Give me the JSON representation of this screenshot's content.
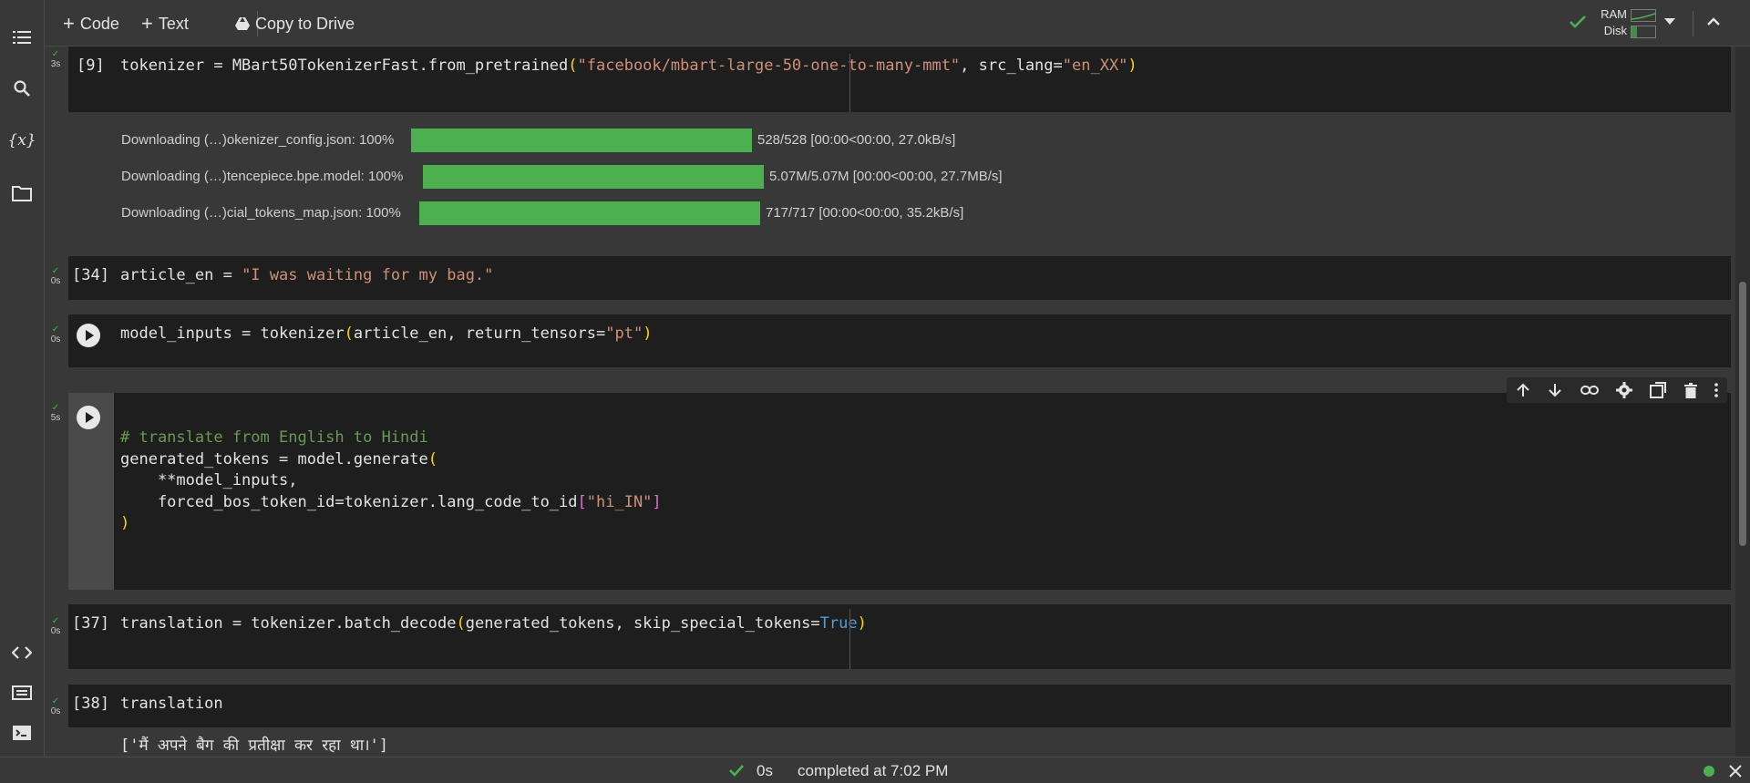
{
  "toolbar": {
    "add_code": "Code",
    "add_text": "Text",
    "copy_to_drive": "Copy to Drive",
    "ram_label": "RAM",
    "disk_label": "Disk"
  },
  "cells": {
    "c9": {
      "exec": "[9]",
      "time": "3s",
      "code_prefix": "tokenizer = MBart50TokenizerFast.from_pretrained",
      "arg1": "\"facebook/mbart-large-50-one-to-many-mmt\"",
      "mid": ", src_lang=",
      "arg2": "\"en_XX\""
    },
    "downloads": [
      {
        "label": "Downloading (…)okenizer_config.json: 100%",
        "progress": 100,
        "stats": "528/528 [00:00<00:00, 27.0kB/s]"
      },
      {
        "label": "Downloading (…)tencepiece.bpe.model: 100%",
        "progress": 100,
        "stats": "5.07M/5.07M [00:00<00:00, 27.7MB/s]"
      },
      {
        "label": "Downloading (…)cial_tokens_map.json: 100%",
        "progress": 100,
        "stats": "717/717 [00:00<00:00, 35.2kB/s]"
      }
    ],
    "c34": {
      "exec": "[34]",
      "time": "0s",
      "code_prefix": "article_en = ",
      "str": "\"I was waiting for my bag.\""
    },
    "c_inputs": {
      "time": "0s",
      "code_prefix": "model_inputs = tokenizer",
      "args": "article_en, return_tensors=",
      "str": "\"pt\""
    },
    "c_generate": {
      "time": "5s",
      "comment": "# translate from English to Hindi",
      "line2_prefix": "generated_tokens = model.generate",
      "line3": "    **model_inputs,",
      "line4_prefix": "    forced_bos_token_id=tokenizer.lang_code_to_id",
      "line4_str": "\"hi_IN\""
    },
    "c37": {
      "exec": "[37]",
      "time": "0s",
      "code_prefix": "translation = tokenizer.batch_decode",
      "args": "generated_tokens, skip_special_tokens=",
      "kw": "True"
    },
    "c38": {
      "exec": "[38]",
      "time": "0s",
      "code": "translation",
      "output": "['मैं अपने बैग की प्रतीक्षा कर रहा था।']"
    }
  },
  "status": {
    "duration": "0s",
    "completed": "completed at 7:02 PM"
  },
  "colors": {
    "accent_green": "#4caf50",
    "string": "#ce9178",
    "comment": "#6a9955",
    "keyword": "#569cd6"
  }
}
